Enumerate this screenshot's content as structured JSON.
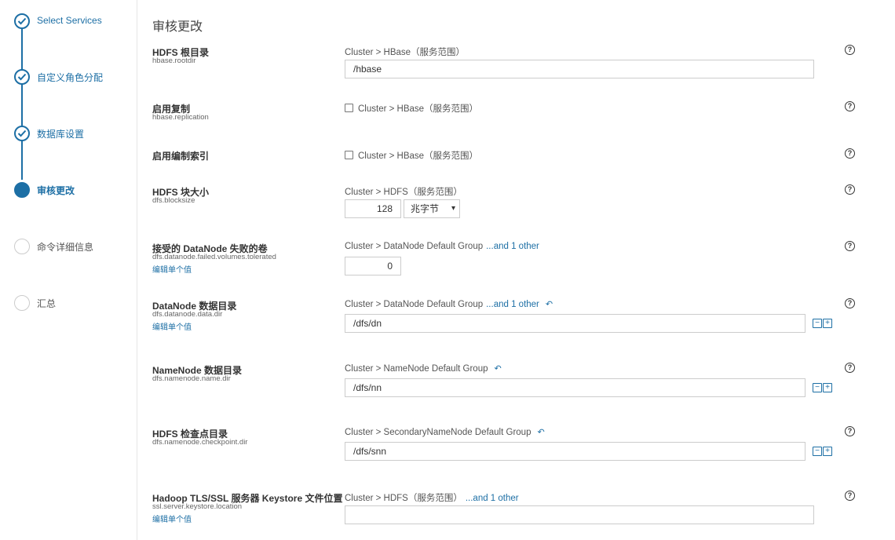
{
  "sidebar": {
    "steps": [
      {
        "label": "Select Services",
        "state": "done"
      },
      {
        "label": "自定义角色分配",
        "state": "done"
      },
      {
        "label": "数据库设置",
        "state": "done"
      },
      {
        "label": "审核更改",
        "state": "active"
      },
      {
        "label": "命令详细信息",
        "state": "todo"
      },
      {
        "label": "汇总",
        "state": "todo"
      }
    ]
  },
  "page": {
    "title": "审核更改"
  },
  "params": [
    {
      "name": "HDFS 根目录",
      "key": "hbase.rootdir",
      "scope": "Cluster > HBase（服务范围）",
      "value": "/hbase",
      "help": "?"
    },
    {
      "name": "启用复制",
      "key": "hbase.replication",
      "scope": "Cluster > HBase（服务范围）",
      "help": "?"
    },
    {
      "name": "启用编制索引",
      "scope": "Cluster > HBase（服务范围）",
      "help": "?"
    },
    {
      "name": "HDFS 块大小",
      "key": "dfs.blocksize",
      "scope": "Cluster > HDFS（服务范围）",
      "value": "128",
      "unit": "兆字节",
      "help": "?"
    },
    {
      "name": "接受的 DataNode 失败的卷",
      "key": "dfs.datanode.failed.volumes.tolerated",
      "edit": "编辑单个值",
      "scope": "Cluster > DataNode Default Group",
      "more": "...and 1 other",
      "value": "0",
      "help": "?"
    },
    {
      "name": "DataNode 数据目录",
      "key": "dfs.datanode.data.dir",
      "edit": "编辑单个值",
      "scope": "Cluster > DataNode Default Group",
      "more": "...and 1 other",
      "value": "/dfs/dn",
      "help": "?"
    },
    {
      "name": "NameNode 数据目录",
      "key": "dfs.namenode.name.dir",
      "scope": "Cluster > NameNode Default Group",
      "value": "/dfs/nn",
      "help": "?"
    },
    {
      "name": "HDFS 检查点目录",
      "key": "dfs.namenode.checkpoint.dir",
      "scope": "Cluster > SecondaryNameNode Default Group",
      "value": "/dfs/snn",
      "help": "?"
    },
    {
      "name": "Hadoop TLS/SSL 服务器 Keystore 文件位置",
      "key": "ssl.server.keystore.location",
      "edit": "编辑单个值",
      "scope": "Cluster > HDFS（服务范围）",
      "more": "...and 1 other",
      "value": "",
      "help": "?"
    }
  ],
  "icons": {
    "check": "checkmark-icon",
    "undo": "undo-icon",
    "help": "help-icon",
    "minus": "minus-icon",
    "plus": "plus-icon"
  },
  "colors": {
    "accent": "#1d6fa5",
    "border": "#cccccc"
  }
}
